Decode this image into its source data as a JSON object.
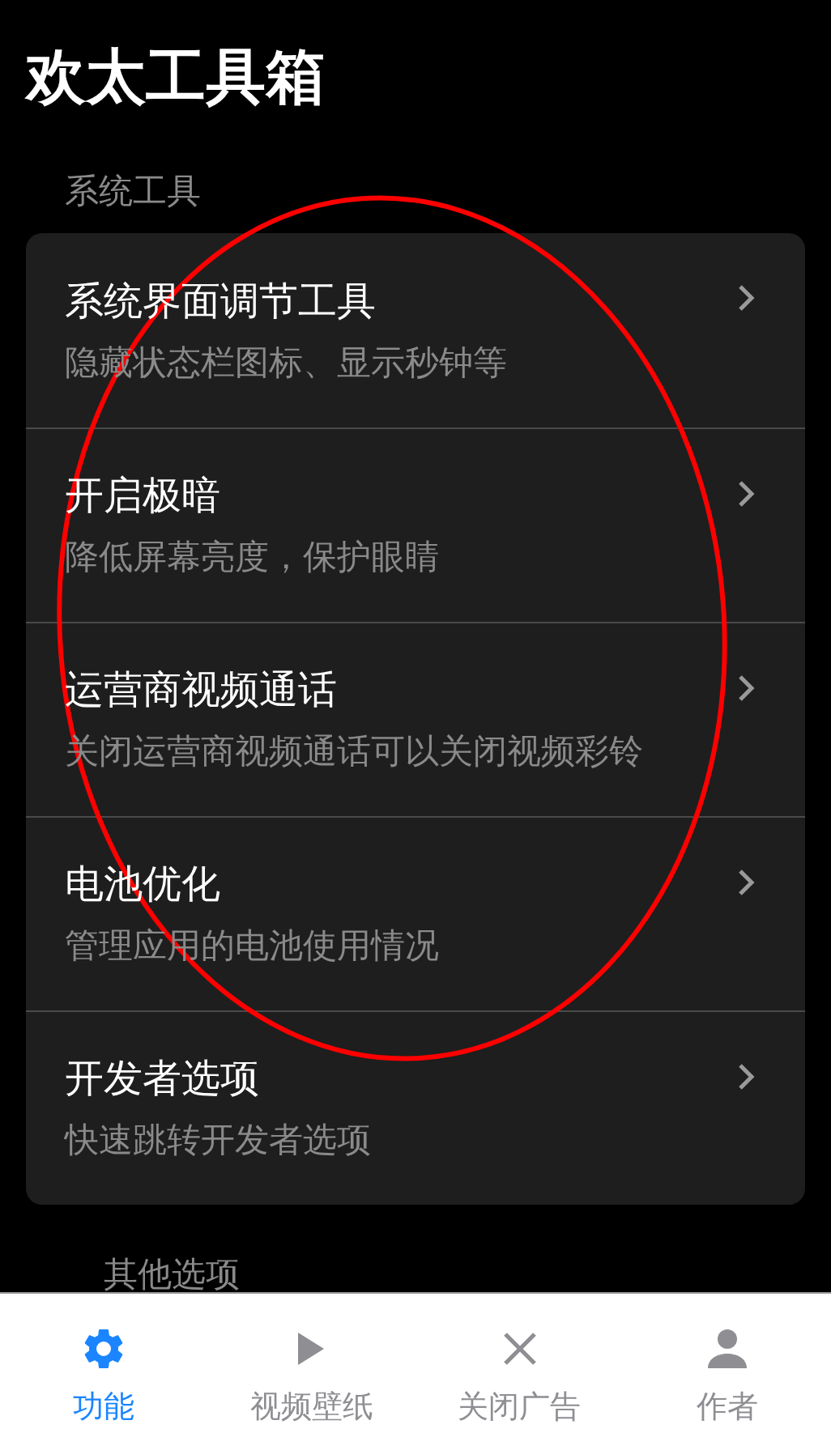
{
  "title": "欢太工具箱",
  "sections": [
    {
      "label": "系统工具",
      "items": [
        {
          "title": "系统界面调节工具",
          "subtitle": "隐藏状态栏图标、显示秒钟等"
        },
        {
          "title": "开启极暗",
          "subtitle": "降低屏幕亮度，保护眼睛"
        },
        {
          "title": "运营商视频通话",
          "subtitle": "关闭运营商视频通话可以关闭视频彩铃"
        },
        {
          "title": "电池优化",
          "subtitle": "管理应用的电池使用情况"
        },
        {
          "title": "开发者选项",
          "subtitle": "快速跳转开发者选项"
        }
      ]
    },
    {
      "label": "其他选项"
    }
  ],
  "tabs": [
    {
      "label": "功能",
      "kind": "gear",
      "selected": true
    },
    {
      "label": "视频壁纸",
      "kind": "play",
      "selected": false
    },
    {
      "label": "关闭广告",
      "kind": "close",
      "selected": false
    },
    {
      "label": "作者",
      "kind": "person",
      "selected": false
    }
  ]
}
